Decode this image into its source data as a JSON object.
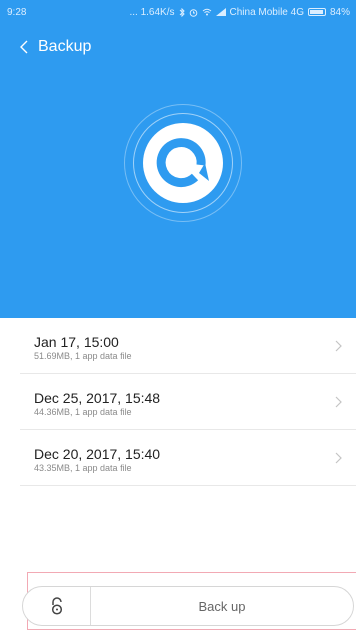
{
  "status_bar": {
    "time": "9:28",
    "net_speed": "... 1.64K/s",
    "carrier": "China Mobile 4G",
    "battery": "84%"
  },
  "header": {
    "title": "Backup"
  },
  "backups": [
    {
      "date": "Jan 17, 15:00",
      "details": "51.69MB, 1 app data file"
    },
    {
      "date": "Dec 25, 2017, 15:48",
      "details": "44.36MB, 1 app data file"
    },
    {
      "date": "Dec 20, 2017, 15:40",
      "details": "43.35MB, 1 app data file"
    }
  ],
  "footer": {
    "backup_label": "Back up"
  },
  "colors": {
    "accent": "#2e9bf0"
  }
}
